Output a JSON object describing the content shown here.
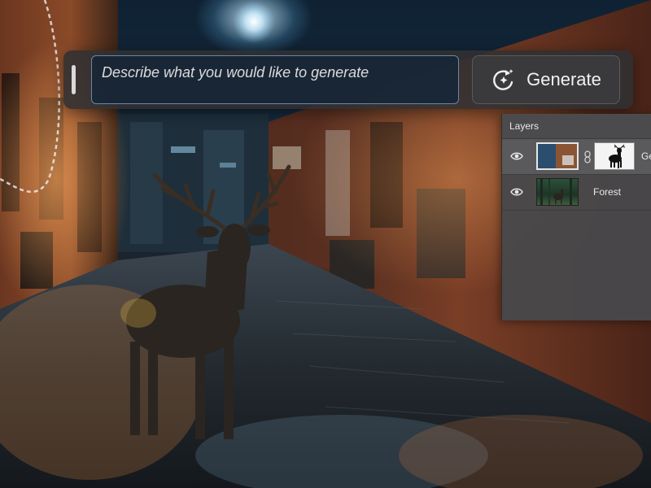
{
  "prompt_bar": {
    "placeholder": "Describe what you would like to generate",
    "generate_label": "Generate",
    "generate_icon": "sparkle-refresh-icon"
  },
  "layers_panel": {
    "title": "Layers",
    "layers": [
      {
        "name": "Ge",
        "visible": true,
        "has_mask": true,
        "selected": true
      },
      {
        "name": "Forest",
        "visible": true,
        "has_mask": false,
        "selected": false
      }
    ]
  },
  "colors": {
    "prompt_bg": "#303032",
    "input_border": "#6a86a8",
    "panel_bg": "#48484a",
    "selected_row": "#5a5a5c"
  }
}
